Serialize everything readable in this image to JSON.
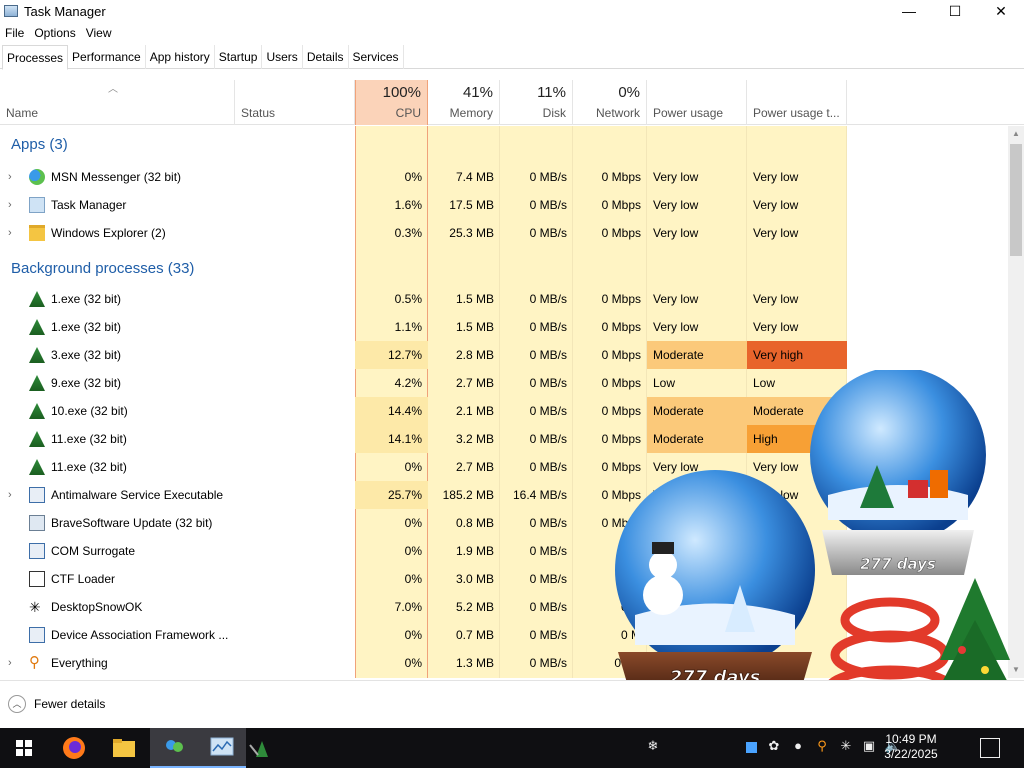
{
  "window": {
    "title": "Task Manager"
  },
  "window_controls": {
    "minimize": "—",
    "maximize": "☐",
    "close": "✕"
  },
  "menu": [
    "File",
    "Options",
    "View"
  ],
  "tabs": [
    "Processes",
    "Performance",
    "App history",
    "Startup",
    "Users",
    "Details",
    "Services"
  ],
  "columns": {
    "name": "Name",
    "status": "Status",
    "cpu": {
      "pct": "100%",
      "label": "CPU"
    },
    "memory": {
      "pct": "41%",
      "label": "Memory"
    },
    "disk": {
      "pct": "11%",
      "label": "Disk"
    },
    "network": {
      "pct": "0%",
      "label": "Network"
    },
    "power": "Power usage",
    "power_trend": "Power usage t..."
  },
  "groups": {
    "apps": "Apps (3)",
    "background": "Background processes (33)"
  },
  "apps": [
    {
      "name": "MSN Messenger (32 bit)",
      "cpu": "0%",
      "mem": "7.4 MB",
      "disk": "0 MB/s",
      "net": "0 Mbps",
      "power": "Very low",
      "trend": "Very low",
      "expand": true,
      "icon": "msn-icon"
    },
    {
      "name": "Task Manager",
      "cpu": "1.6%",
      "mem": "17.5 MB",
      "disk": "0 MB/s",
      "net": "0 Mbps",
      "power": "Very low",
      "trend": "Very low",
      "expand": true,
      "icon": "task-manager-icon"
    },
    {
      "name": "Windows Explorer (2)",
      "cpu": "0.3%",
      "mem": "25.3 MB",
      "disk": "0 MB/s",
      "net": "0 Mbps",
      "power": "Very low",
      "trend": "Very low",
      "expand": true,
      "icon": "folder-icon"
    }
  ],
  "background": [
    {
      "name": "1.exe (32 bit)",
      "cpu": "0.5%",
      "mem": "1.5 MB",
      "disk": "0 MB/s",
      "net": "0 Mbps",
      "power": "Very low",
      "trend": "Very low",
      "expand": false,
      "icon": "tree-icon"
    },
    {
      "name": "1.exe (32 bit)",
      "cpu": "1.1%",
      "mem": "1.5 MB",
      "disk": "0 MB/s",
      "net": "0 Mbps",
      "power": "Very low",
      "trend": "Very low",
      "expand": false,
      "icon": "tree-icon"
    },
    {
      "name": "3.exe (32 bit)",
      "cpu": "12.7%",
      "mem": "2.8 MB",
      "disk": "0 MB/s",
      "net": "0 Mbps",
      "power": "Moderate",
      "trend": "Very high",
      "expand": false,
      "icon": "tree-icon"
    },
    {
      "name": "9.exe (32 bit)",
      "cpu": "4.2%",
      "mem": "2.7 MB",
      "disk": "0 MB/s",
      "net": "0 Mbps",
      "power": "Low",
      "trend": "Low",
      "expand": false,
      "icon": "tree-icon"
    },
    {
      "name": "10.exe (32 bit)",
      "cpu": "14.4%",
      "mem": "2.1 MB",
      "disk": "0 MB/s",
      "net": "0 Mbps",
      "power": "Moderate",
      "trend": "Moderate",
      "expand": false,
      "icon": "tree-icon"
    },
    {
      "name": "11.exe (32 bit)",
      "cpu": "14.1%",
      "mem": "3.2 MB",
      "disk": "0 MB/s",
      "net": "0 Mbps",
      "power": "Moderate",
      "trend": "High",
      "expand": false,
      "icon": "tree-icon"
    },
    {
      "name": "11.exe (32 bit)",
      "cpu": "0%",
      "mem": "2.7 MB",
      "disk": "0 MB/s",
      "net": "0 Mbps",
      "power": "Very low",
      "trend": "Very low",
      "expand": false,
      "icon": "tree-icon"
    },
    {
      "name": "Antimalware Service Executable",
      "cpu": "25.7%",
      "mem": "185.2 MB",
      "disk": "16.4 MB/s",
      "net": "0 Mbps",
      "power": "Ver",
      "trend": "Very low",
      "expand": true,
      "icon": "service-icon"
    },
    {
      "name": "BraveSoftware Update (32 bit)",
      "cpu": "0%",
      "mem": "0.8 MB",
      "disk": "0 MB/s",
      "net": "0 Mbps",
      "power": "",
      "trend": "",
      "expand": false,
      "icon": "brave-update-icon"
    },
    {
      "name": "COM Surrogate",
      "cpu": "0%",
      "mem": "1.9 MB",
      "disk": "0 MB/s",
      "net": "0 M",
      "power": "",
      "trend": "",
      "expand": false,
      "icon": "service-icon"
    },
    {
      "name": "CTF Loader",
      "cpu": "0%",
      "mem": "3.0 MB",
      "disk": "0 MB/s",
      "net": "0 M",
      "power": "",
      "trend": "",
      "expand": false,
      "icon": "ctf-icon"
    },
    {
      "name": "DesktopSnowOK",
      "cpu": "7.0%",
      "mem": "5.2 MB",
      "disk": "0 MB/s",
      "net": "0 M",
      "power": "",
      "trend": "",
      "expand": false,
      "icon": "snowflake-icon"
    },
    {
      "name": "Device Association Framework ...",
      "cpu": "0%",
      "mem": "0.7 MB",
      "disk": "0 MB/s",
      "net": "0 M",
      "power": "",
      "trend": "",
      "expand": false,
      "icon": "service-icon"
    },
    {
      "name": "Everything",
      "cpu": "0%",
      "mem": "1.3 MB",
      "disk": "0 MB/s",
      "net": "0 Mb",
      "power": "",
      "trend": "",
      "expand": true,
      "icon": "magnifier-icon"
    }
  ],
  "footer": {
    "fewer_details": "Fewer details"
  },
  "globe_text": {
    "left": "277 days",
    "right": "277 days"
  },
  "clock": {
    "time": "10:49 PM",
    "date": "3/22/2025"
  },
  "colors": {
    "cpu_header": "#fbd3b9",
    "heat_light": "#fff4c4",
    "heat_mid": "#fde9a8",
    "moderate": "#fbc97a",
    "high": "#f7a035",
    "very_high": "#e8642b",
    "group_text": "#1f5ea8"
  }
}
